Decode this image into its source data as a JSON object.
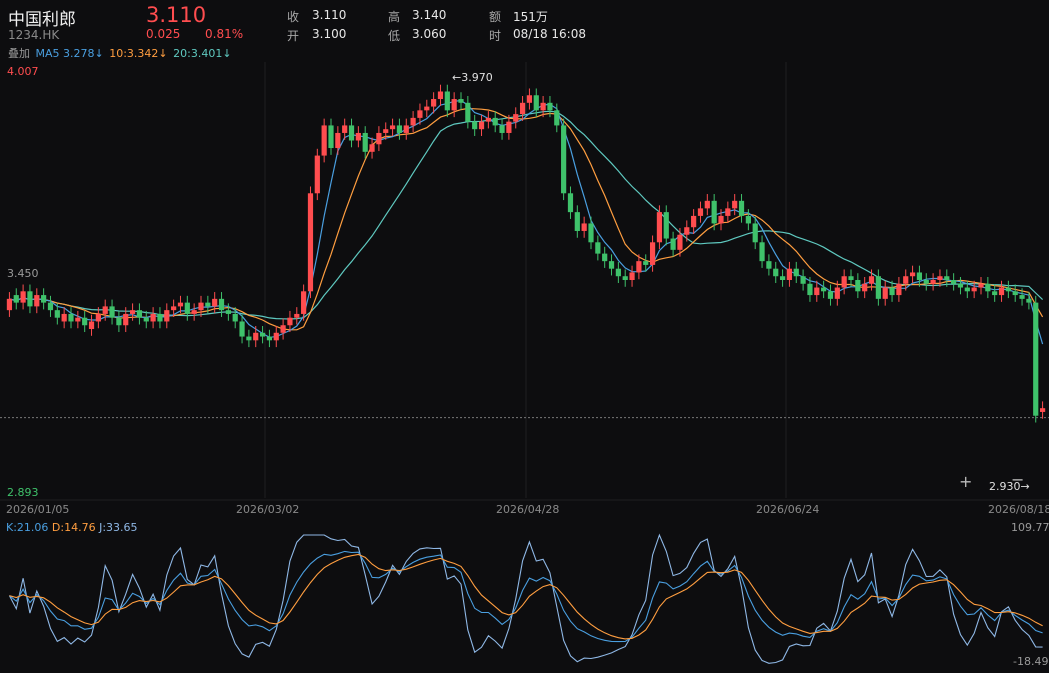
{
  "header": {
    "name": "中国利郎",
    "code": "1234.HK",
    "price": "3.110",
    "change": "0.025",
    "change_pct": "0.81%",
    "stats": [
      {
        "label": "收",
        "value": "3.110"
      },
      {
        "label": "高",
        "value": "3.140"
      },
      {
        "label": "额",
        "value": "151万"
      },
      {
        "label": "开",
        "value": "3.100"
      },
      {
        "label": "低",
        "value": "3.060"
      },
      {
        "label": "时",
        "value": "08/18 16:08"
      }
    ]
  },
  "ma_row": {
    "overlay": "叠加",
    "ma5": "MA5 3.278↓",
    "ma10": "10:3.342↓",
    "ma20": "20:3.401↓"
  },
  "kdj_row": {
    "k": "K:21.06",
    "d": "D:14.76",
    "j": "J:33.65",
    "max": "109.77",
    "min": "-18.49"
  },
  "controls": {
    "zoom_in": "+",
    "zoom_out": "−"
  },
  "colors": {
    "up": "#ff4d4f",
    "down": "#3fc26b",
    "ma5": "#4a9fe0",
    "ma10": "#ff9e40",
    "ma20": "#5fc9c0",
    "k": "#4a9fe0",
    "d": "#ff9e40",
    "j": "#8fb8e6"
  },
  "chart_data": [
    {
      "type": "candlestick",
      "y_axis_labels": [
        "4.007",
        "3.450",
        "2.893"
      ],
      "ylim": [
        2.893,
        4.007
      ],
      "x_tick_labels": [
        "2026/01/05",
        "2026/03/02",
        "2026/04/28",
        "2026/06/24",
        "2026/08/18"
      ],
      "annotations": {
        "high": "←3.970",
        "low": "2.930→"
      },
      "reference_price": 3.085,
      "series": [
        {
          "name": "MA5",
          "legend": "MA5 3.278↓"
        },
        {
          "name": "MA10",
          "legend": "10:3.342↓"
        },
        {
          "name": "MA20",
          "legend": "20:3.401↓"
        }
      ],
      "close": [
        3.4,
        3.39,
        3.42,
        3.38,
        3.41,
        3.39,
        3.37,
        3.35,
        3.36,
        3.34,
        3.35,
        3.33,
        3.34,
        3.36,
        3.38,
        3.35,
        3.33,
        3.36,
        3.37,
        3.35,
        3.34,
        3.36,
        3.34,
        3.37,
        3.38,
        3.39,
        3.36,
        3.37,
        3.39,
        3.38,
        3.4,
        3.37,
        3.36,
        3.34,
        3.3,
        3.29,
        3.31,
        3.3,
        3.29,
        3.31,
        3.33,
        3.35,
        3.36,
        3.42,
        3.68,
        3.78,
        3.86,
        3.8,
        3.84,
        3.86,
        3.82,
        3.84,
        3.79,
        3.81,
        3.84,
        3.85,
        3.86,
        3.84,
        3.86,
        3.88,
        3.9,
        3.91,
        3.93,
        3.95,
        3.9,
        3.93,
        3.92,
        3.87,
        3.85,
        3.87,
        3.88,
        3.86,
        3.84,
        3.87,
        3.89,
        3.92,
        3.94,
        3.9,
        3.92,
        3.9,
        3.86,
        3.68,
        3.63,
        3.58,
        3.6,
        3.55,
        3.52,
        3.5,
        3.48,
        3.46,
        3.45,
        3.47,
        3.5,
        3.49,
        3.55,
        3.63,
        3.56,
        3.53,
        3.57,
        3.59,
        3.62,
        3.64,
        3.66,
        3.6,
        3.62,
        3.64,
        3.66,
        3.62,
        3.6,
        3.55,
        3.5,
        3.48,
        3.46,
        3.45,
        3.48,
        3.46,
        3.44,
        3.41,
        3.43,
        3.42,
        3.4,
        3.43,
        3.46,
        3.45,
        3.42,
        3.44,
        3.46,
        3.4,
        3.43,
        3.41,
        3.44,
        3.46,
        3.47,
        3.45,
        3.44,
        3.45,
        3.46,
        3.45,
        3.44,
        3.43,
        3.42,
        3.43,
        3.44,
        3.42,
        3.41,
        3.43,
        3.42,
        3.41,
        3.4,
        3.39,
        3.09,
        3.11
      ],
      "open": [
        3.37,
        3.41,
        3.39,
        3.42,
        3.38,
        3.41,
        3.39,
        3.37,
        3.34,
        3.36,
        3.34,
        3.35,
        3.32,
        3.34,
        3.36,
        3.38,
        3.35,
        3.33,
        3.36,
        3.37,
        3.35,
        3.34,
        3.36,
        3.34,
        3.37,
        3.38,
        3.39,
        3.36,
        3.37,
        3.39,
        3.38,
        3.4,
        3.37,
        3.36,
        3.34,
        3.3,
        3.29,
        3.31,
        3.3,
        3.29,
        3.31,
        3.33,
        3.35,
        3.36,
        3.42,
        3.68,
        3.78,
        3.86,
        3.8,
        3.84,
        3.86,
        3.82,
        3.84,
        3.79,
        3.81,
        3.84,
        3.85,
        3.86,
        3.84,
        3.86,
        3.88,
        3.9,
        3.91,
        3.93,
        3.95,
        3.9,
        3.93,
        3.92,
        3.87,
        3.85,
        3.87,
        3.88,
        3.86,
        3.84,
        3.87,
        3.89,
        3.92,
        3.94,
        3.9,
        3.92,
        3.9,
        3.86,
        3.68,
        3.63,
        3.58,
        3.6,
        3.55,
        3.52,
        3.5,
        3.48,
        3.46,
        3.45,
        3.47,
        3.5,
        3.49,
        3.55,
        3.63,
        3.56,
        3.53,
        3.57,
        3.59,
        3.62,
        3.64,
        3.66,
        3.6,
        3.62,
        3.64,
        3.66,
        3.62,
        3.6,
        3.55,
        3.5,
        3.48,
        3.46,
        3.45,
        3.48,
        3.46,
        3.44,
        3.41,
        3.43,
        3.42,
        3.4,
        3.43,
        3.46,
        3.45,
        3.42,
        3.44,
        3.46,
        3.4,
        3.43,
        3.41,
        3.44,
        3.46,
        3.47,
        3.45,
        3.44,
        3.45,
        3.46,
        3.45,
        3.44,
        3.43,
        3.42,
        3.43,
        3.44,
        3.42,
        3.41,
        3.43,
        3.42,
        3.41,
        3.4,
        3.39,
        3.1
      ]
    },
    {
      "type": "line",
      "title": "KDJ",
      "ylim": [
        -18.49,
        109.77
      ],
      "series": [
        {
          "name": "K",
          "legend": "K:21.06"
        },
        {
          "name": "D",
          "legend": "D:14.76"
        },
        {
          "name": "J",
          "legend": "J:33.65"
        }
      ]
    }
  ]
}
